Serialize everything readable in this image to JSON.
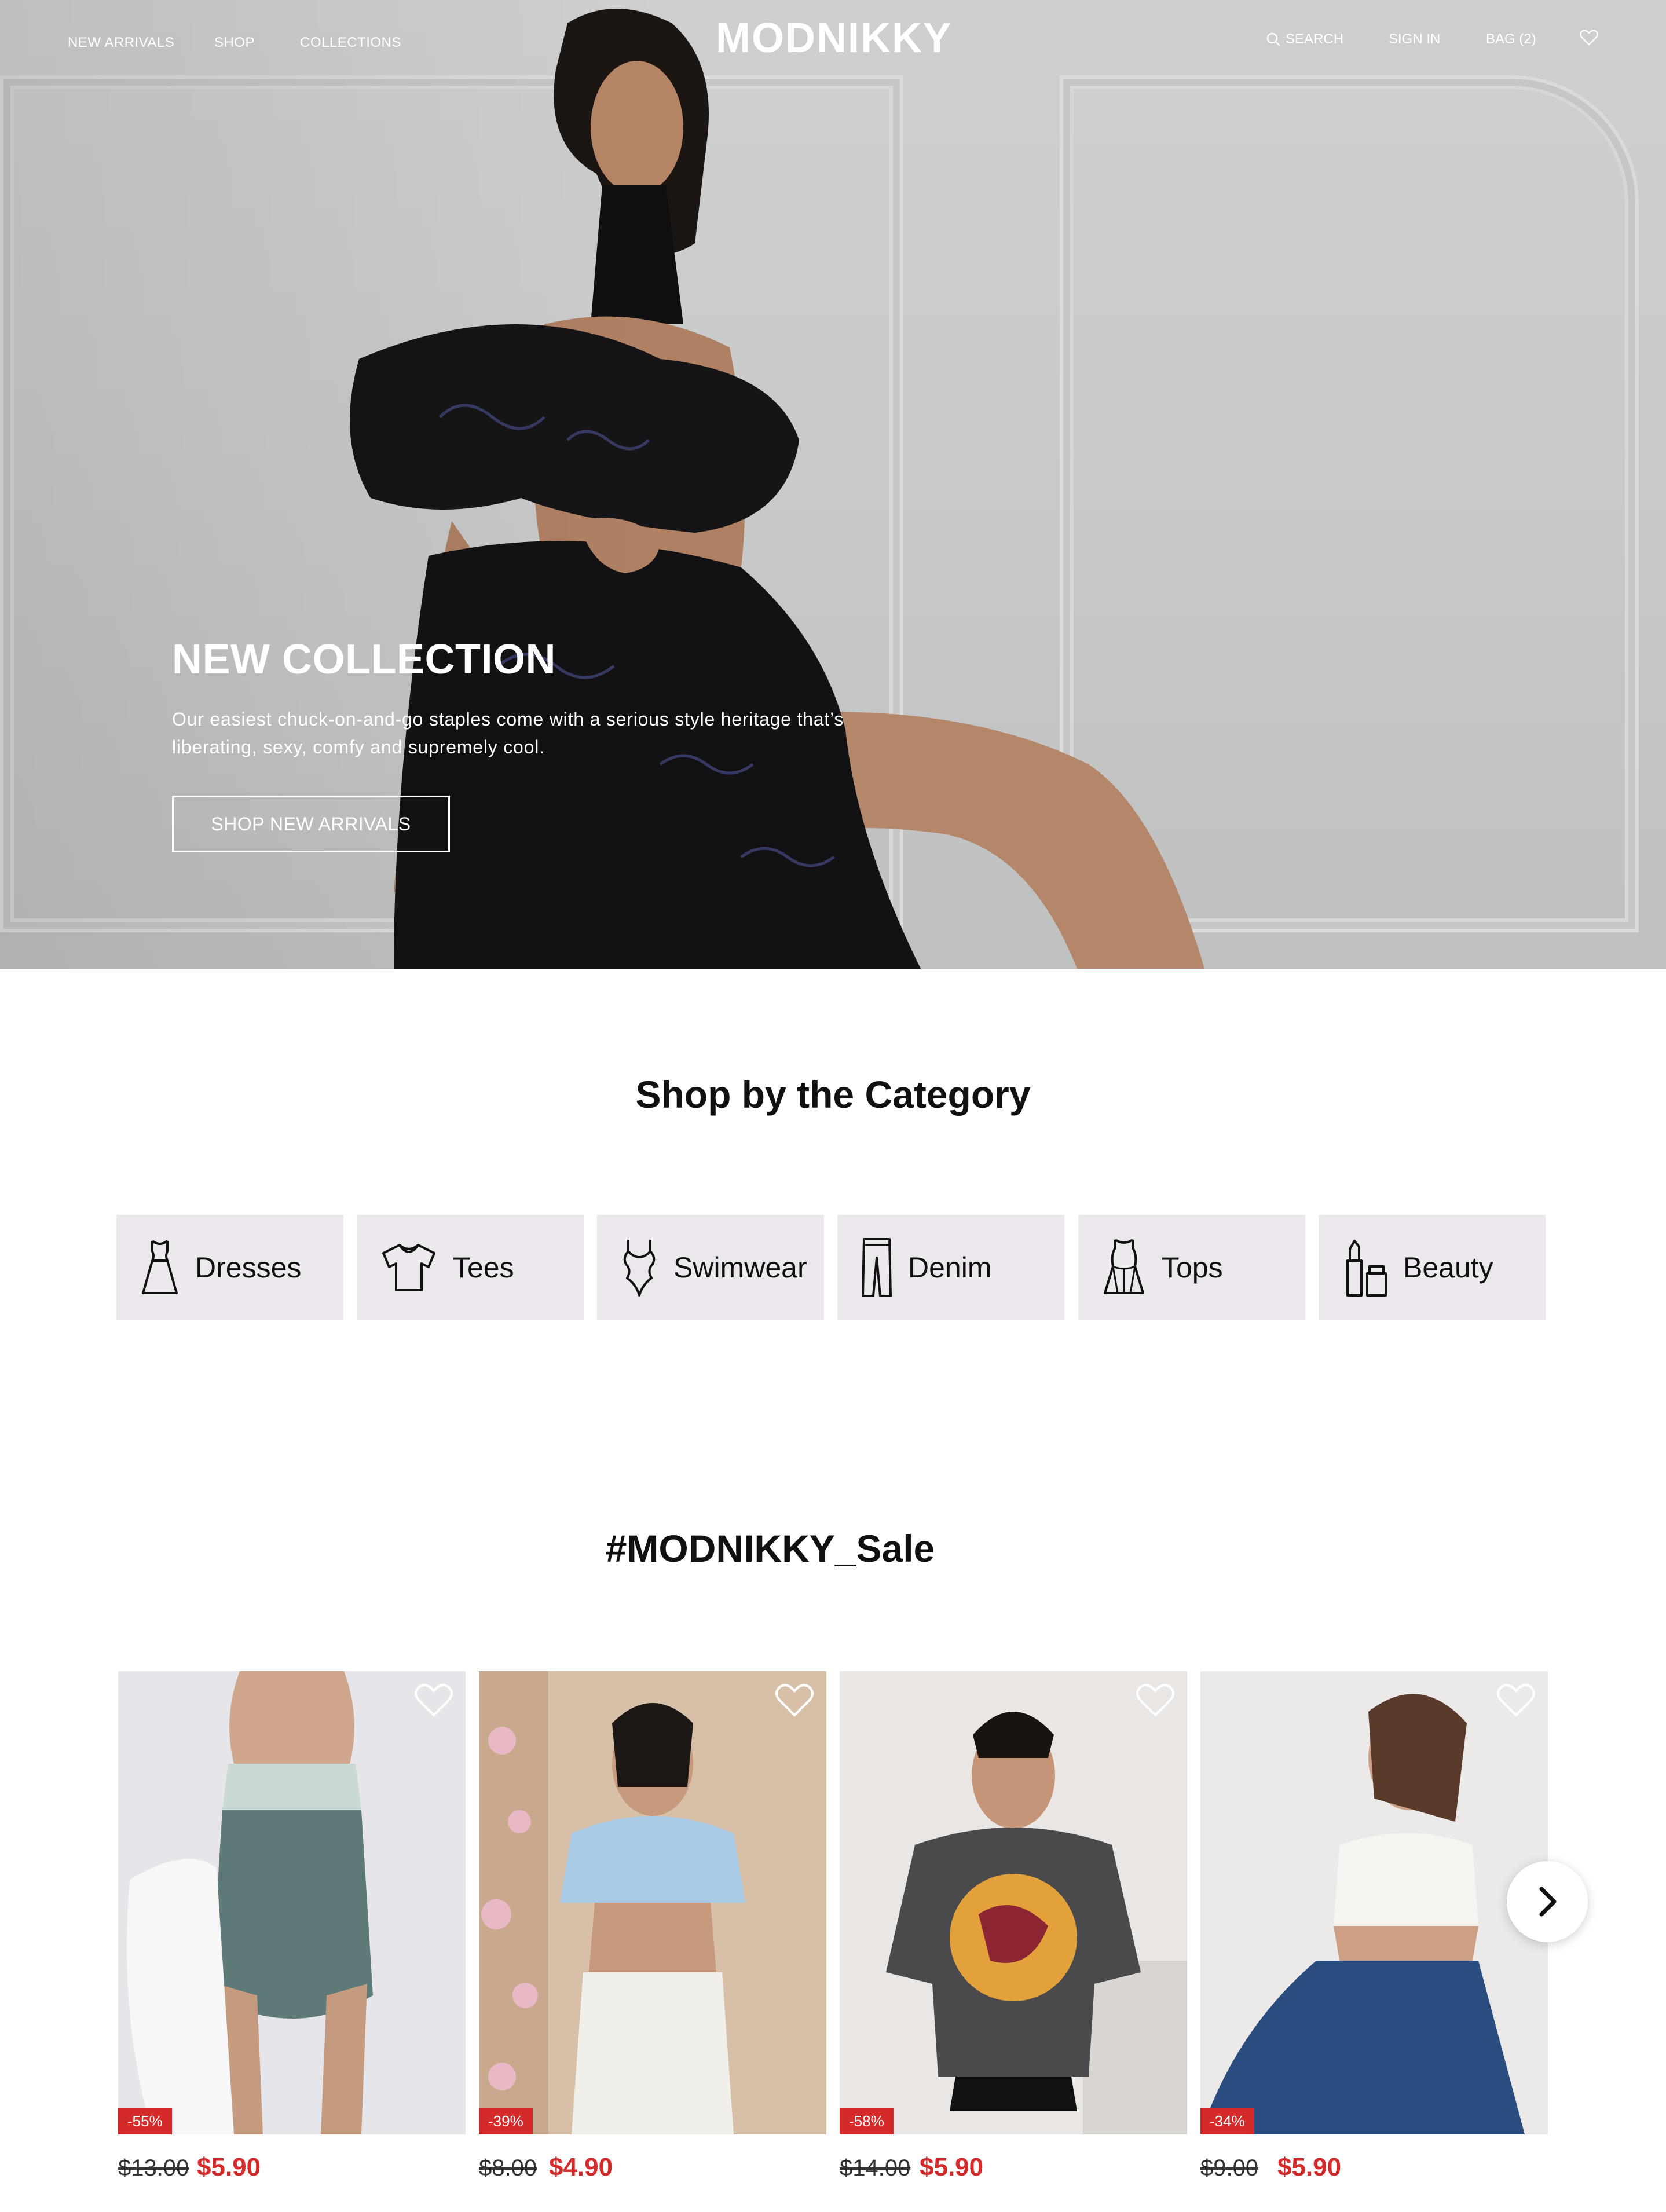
{
  "brand": "MODNIKKY",
  "nav": {
    "left": [
      "NEW ARRIVALS",
      "SHOP",
      "COLLECTIONS"
    ],
    "search": "SEARCH",
    "sign_in": "SIGN IN",
    "bag": "BAG (2)"
  },
  "hero": {
    "title": "NEW COLLECTION",
    "subtitle": "Our easiest chuck-on-and-go staples come with a serious style heritage that’s liberating, sexy, comfy and supremely cool.",
    "cta": "SHOP NEW ARRIVALS"
  },
  "categories_section": {
    "title_prefix": "Shop by the ",
    "title_bold": "Category",
    "items": [
      {
        "label": "Dresses",
        "icon": "dress-icon"
      },
      {
        "label": "Tees",
        "icon": "tshirt-icon"
      },
      {
        "label": "Swimwear",
        "icon": "swimsuit-icon"
      },
      {
        "label": "Denim",
        "icon": "jeans-icon"
      },
      {
        "label": "Tops",
        "icon": "top-icon"
      },
      {
        "label": "Beauty",
        "icon": "lipstick-icon"
      }
    ]
  },
  "sale": {
    "title_prefix": "#MODNIKKY",
    "title_bold": "_Sale",
    "products": [
      {
        "discount": "-55%",
        "old_price": "$13.00",
        "new_price": "$5.90"
      },
      {
        "discount": "-39%",
        "old_price": "$8.00",
        "new_price": "$4.90"
      },
      {
        "discount": "-58%",
        "old_price": "$14.00",
        "new_price": "$5.90"
      },
      {
        "discount": "-34%",
        "old_price": "$9.00",
        "new_price": "$5.90"
      }
    ]
  },
  "colors": {
    "sale_red": "#d42a2a",
    "category_bg": "#ece8ee",
    "hero_bg": "#c9caca"
  }
}
